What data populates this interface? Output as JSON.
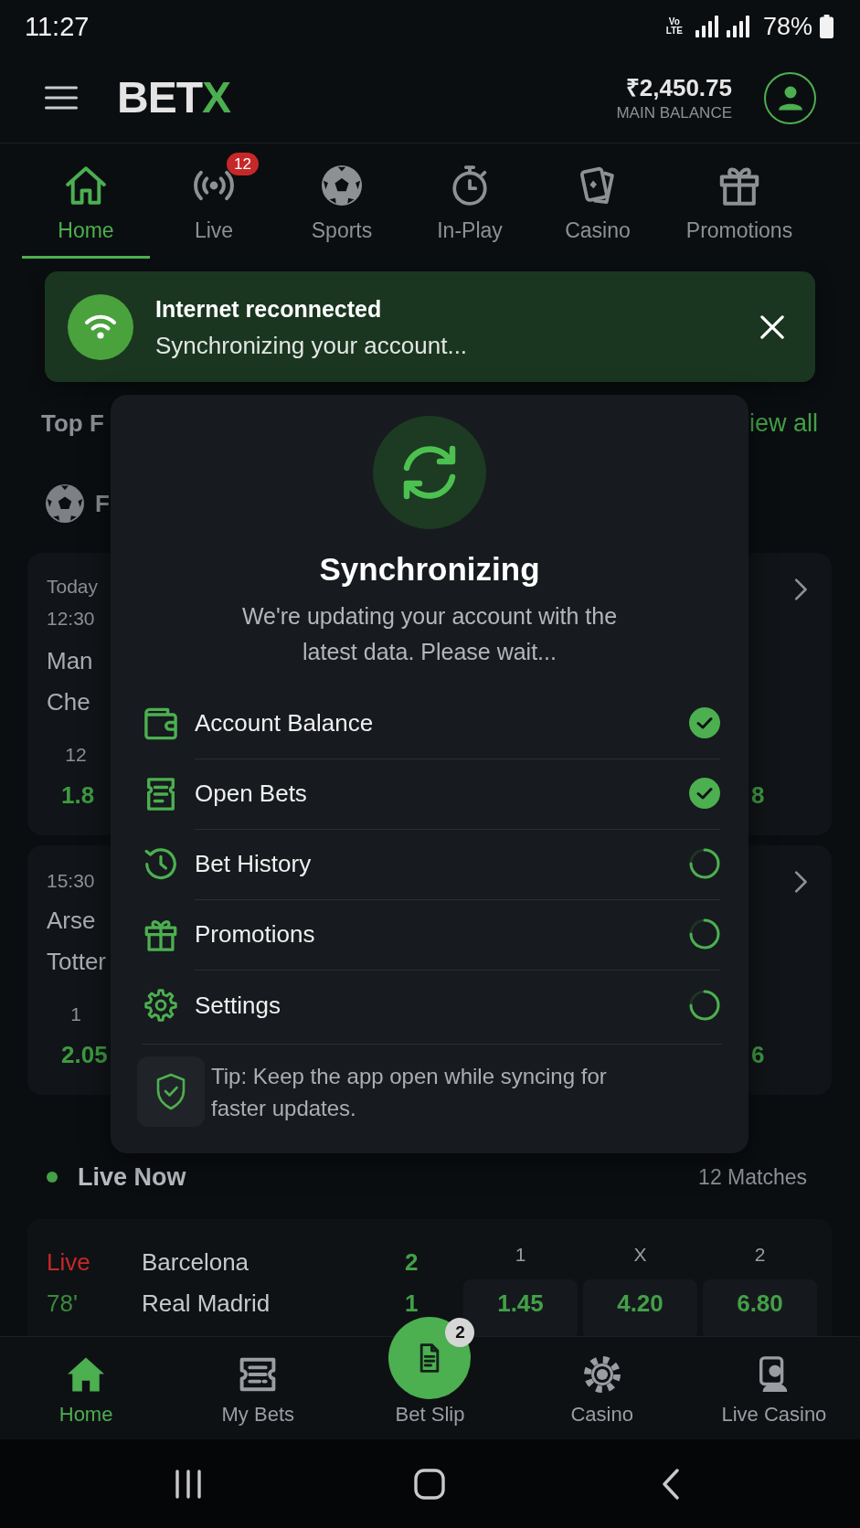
{
  "status_bar": {
    "time": "11:27",
    "network_badge": [
      "Vo",
      "LTE"
    ],
    "battery": "78%"
  },
  "header": {
    "logo": {
      "text": "BET",
      "accent": "X"
    },
    "balance": "₹2,450.75",
    "balance_label": "MAIN BALANCE"
  },
  "tabs": [
    {
      "label": "Home",
      "selected": true
    },
    {
      "label": "Live",
      "selected": false,
      "badge": "12"
    },
    {
      "label": "Sports",
      "selected": false
    },
    {
      "label": "In-Play",
      "selected": false
    },
    {
      "label": "Casino",
      "selected": false
    },
    {
      "label": "Promotions",
      "selected": false
    }
  ],
  "toast": {
    "title": "Internet reconnected",
    "message": "Synchronizing your account..."
  },
  "sync_dialog": {
    "title": "Synchronizing",
    "message": "We're updating your account with the latest data. Please wait...",
    "items": [
      {
        "label": "Account Balance",
        "synced": true
      },
      {
        "label": "Open Bets",
        "synced": true
      },
      {
        "label": "Bet History",
        "synced": false
      },
      {
        "label": "Promotions",
        "synced": false
      },
      {
        "label": "Settings",
        "synced": false
      }
    ],
    "tip": "Tip: Keep the app open while syncing for faster updates."
  },
  "feed": {
    "section_title": "Top F",
    "section_link": "iew all",
    "category": "F",
    "matches": [
      {
        "date": "Today",
        "time": "12:30",
        "team_1": "Man",
        "team_2": "Che",
        "odds_label": "12",
        "odds_1": "1.8",
        "odds_3": "8"
      },
      {
        "time": "15:30",
        "team_1": "Arse",
        "team_2": "Totter",
        "odds_label": "1",
        "odds_1": "2.05",
        "odds_3": "6"
      }
    ]
  },
  "live_now": {
    "title": "Live Now",
    "count": "12 Matches",
    "matches": [
      {
        "status": "Live",
        "minute": "78'",
        "team_1": "Barcelona",
        "team_2": "Real Madrid",
        "score_1": "2",
        "score_2": "1",
        "odds": [
          {
            "label": "1",
            "value": "1.45"
          },
          {
            "label": "X",
            "value": "4.20"
          },
          {
            "label": "2",
            "value": "6.80"
          }
        ]
      }
    ]
  },
  "bottom_nav": [
    {
      "label": "Home",
      "kind": "tab",
      "selected": true
    },
    {
      "label": "My Bets",
      "kind": "tab",
      "selected": false
    },
    {
      "label": "Bet Slip",
      "kind": "action",
      "selected": false,
      "badge": "2"
    },
    {
      "label": "Casino",
      "kind": "tab",
      "selected": false
    },
    {
      "label": "Live Casino",
      "kind": "tab",
      "selected": false
    }
  ]
}
